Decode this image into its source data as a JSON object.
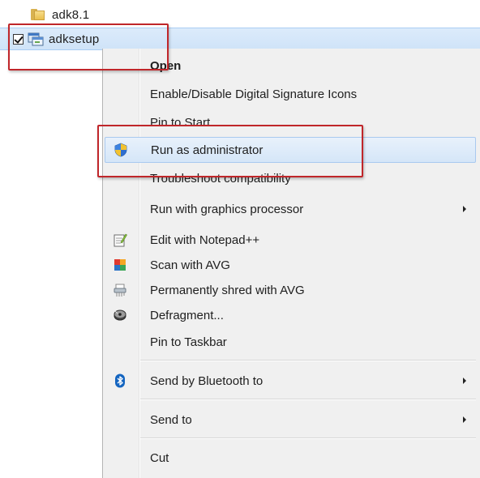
{
  "explorer": {
    "files": [
      {
        "name": "adk8.1",
        "icon": "folder-icon"
      },
      {
        "name": "adksetup",
        "icon": "setup-icon",
        "checked": true,
        "selected": true
      }
    ]
  },
  "context_menu": {
    "items": [
      {
        "label": "Open",
        "bold": true
      },
      {
        "label": "Enable/Disable Digital Signature Icons"
      },
      {
        "label": "Pin to Start"
      },
      {
        "label": "Run as administrator",
        "icon": "uac-shield-icon",
        "hovered": true
      },
      {
        "label": "Troubleshoot compatibility"
      },
      {
        "label": "Run with graphics processor",
        "submenu": true
      },
      {
        "label": "Edit with Notepad++",
        "icon": "notepad-plus-plus-icon"
      },
      {
        "label": "Scan with AVG",
        "icon": "avg-icon"
      },
      {
        "label": "Permanently shred with AVG",
        "icon": "shredder-icon"
      },
      {
        "label": "Defragment...",
        "icon": "defragment-icon"
      },
      {
        "label": "Pin to Taskbar"
      },
      {
        "label": "Send by Bluetooth to",
        "icon": "bluetooth-icon",
        "submenu": true
      },
      {
        "label": "Send to",
        "submenu": true
      },
      {
        "label": "Cut"
      }
    ]
  },
  "colors": {
    "selection_row": "#cfe3f8",
    "highlight_box": "#c0262a",
    "menu_background": "#f0f0f0"
  }
}
